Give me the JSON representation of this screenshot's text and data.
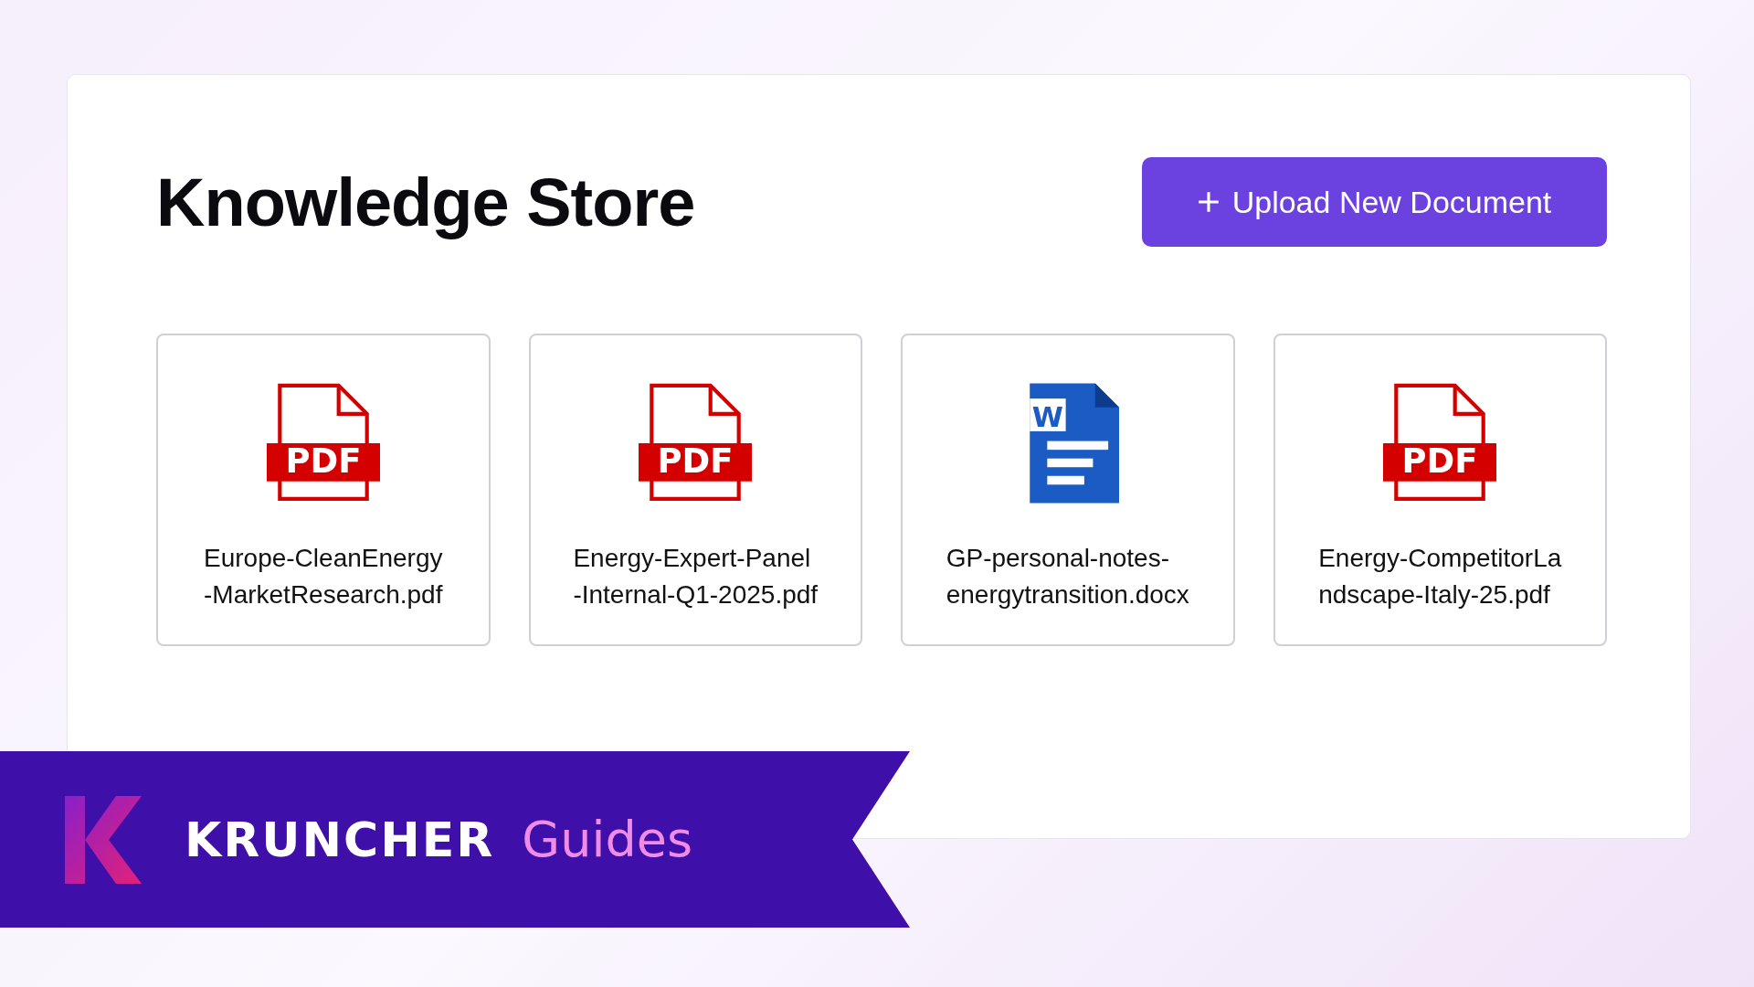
{
  "page": {
    "title": "Knowledge Store"
  },
  "upload_button": {
    "label": "Upload New Document"
  },
  "files": [
    {
      "kind": "pdf",
      "badge": "PDF",
      "name_lines": [
        "Europe-CleanEnergy",
        "-MarketResearch.pdf"
      ]
    },
    {
      "kind": "pdf",
      "badge": "PDF",
      "name_lines": [
        "Energy-Expert-Panel",
        "-Internal-Q1-2025.pdf"
      ]
    },
    {
      "kind": "docx",
      "badge": "W",
      "name_lines": [
        "GP-personal-notes-",
        "energytransition.docx"
      ]
    },
    {
      "kind": "pdf",
      "badge": "PDF",
      "name_lines": [
        "Energy-CompetitorLa",
        "ndscape-Italy-25.pdf"
      ]
    }
  ],
  "banner": {
    "brand": "KRUNCHER",
    "section": "Guides"
  }
}
